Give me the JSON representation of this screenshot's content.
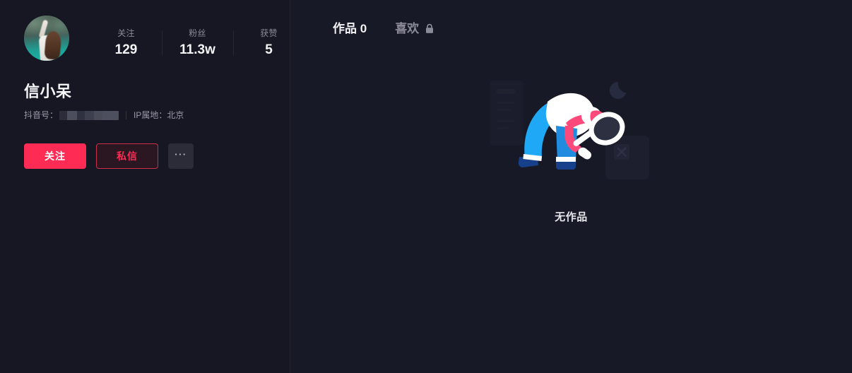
{
  "theme": {
    "bg_left": "#161722",
    "bg_right": "#181926",
    "accent_red": "#fe2c55",
    "text_primary": "#f4f4f6",
    "text_secondary": "#8a8b99",
    "illus_blue": "#1da1f2",
    "illus_pink": "#fe4a7b",
    "illus_white": "#ffffff"
  },
  "profile": {
    "avatar": {
      "icon": "user-avatar-photo",
      "alt": "profile photo"
    },
    "nickname": "信小呆",
    "stats": [
      {
        "label": "关注",
        "value": "129",
        "name": "following"
      },
      {
        "label": "粉丝",
        "value": "11.3w",
        "name": "fans"
      },
      {
        "label": "获赞",
        "value": "5",
        "name": "likes-received"
      }
    ],
    "meta": {
      "douyin_id_label": "抖音号：",
      "douyin_id_value": "",
      "douyin_id_redacted": true,
      "ip_location": "IP属地：北京"
    },
    "actions": {
      "follow_label": "关注",
      "message_label": "私信",
      "more_label": "···"
    }
  },
  "content": {
    "tabs": [
      {
        "label": "作品 0",
        "name": "works",
        "active": true,
        "locked": false
      },
      {
        "label": "喜欢",
        "name": "likes",
        "active": false,
        "locked": true
      }
    ],
    "empty_state": {
      "text": "无作品",
      "illustration": "person-with-magnifying-glass"
    }
  }
}
